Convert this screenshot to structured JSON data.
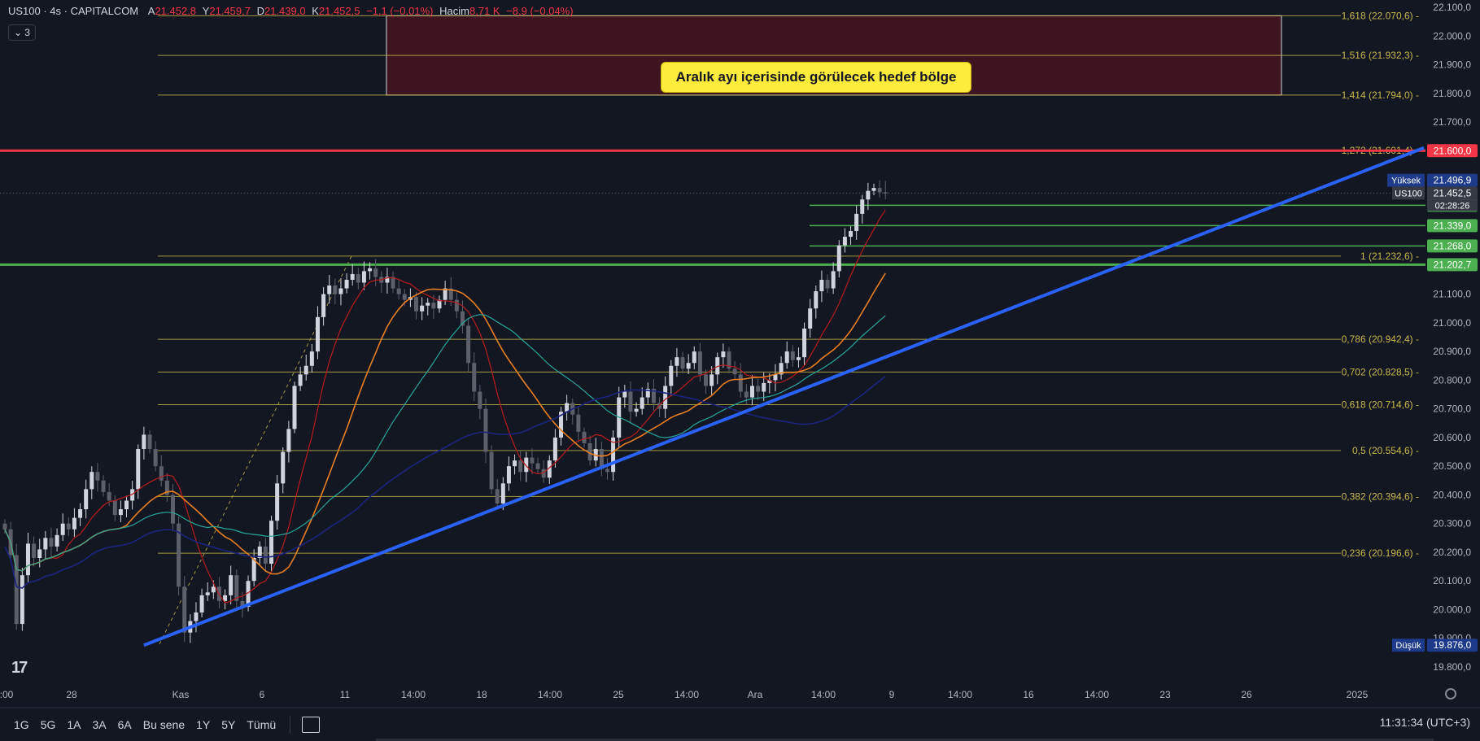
{
  "header": {
    "symbol": "US100 · 4s · CAPITALCOM",
    "open_label": "A",
    "open": "21.452,8",
    "high_label": "Y",
    "high": "21.459,7",
    "low_label": "D",
    "low": "21.439,0",
    "close_label": "K",
    "close": "21.452,5",
    "change": "−1,1 (−0,01%)",
    "volume_label": "Hacim",
    "volume": "8,71 K",
    "volume_change": "−8,9 (−0,04%)",
    "indicator_count": "3"
  },
  "annotation": {
    "target_zone_text": "Aralık ayı içerisinde görülecek hedef bölge"
  },
  "toolbar": {
    "timeframes": [
      "1G",
      "5G",
      "1A",
      "3A",
      "6A",
      "Bu sene",
      "1Y",
      "5Y",
      "Tümü"
    ],
    "clock": "11:31:34 (UTC+3)"
  },
  "colors": {
    "background": "#131722",
    "up_candle": "#d1d4dc",
    "down_candle": "#5d606b",
    "fib": "#c9b84c",
    "resistance": "#f23645",
    "support": "#4caf50",
    "trendline": "#2962ff",
    "target_zone": "#3d1420"
  },
  "chart_data": {
    "type": "candlestick",
    "title": "US100 · 4s · CAPITALCOM",
    "ylim": [
      19800,
      22100
    ],
    "y_ticks": [
      "22.100,0",
      "22.000,0",
      "21.900,0",
      "21.800,0",
      "21.700,0",
      "21.100,0",
      "21.000,0",
      "20.900,0",
      "20.800,0",
      "20.700,0",
      "20.600,0",
      "20.500,0",
      "20.400,0",
      "20.300,0",
      "20.200,0",
      "20.100,0",
      "20.000,0",
      "19.900,0",
      "19.800,0"
    ],
    "x_ticks": [
      ":00",
      "28",
      "Kas",
      "6",
      "11",
      "14:00",
      "18",
      "14:00",
      "25",
      "14:00",
      "Ara",
      "14:00",
      "9",
      "14:00",
      "16",
      "14:00",
      "23",
      "26",
      "2025"
    ],
    "fibonacci": [
      {
        "ratio": "1,618",
        "value": 22070.6,
        "label": "1,618 (22.070,6)"
      },
      {
        "ratio": "1,516",
        "value": 21932.3,
        "label": "1,516 (21.932,3)"
      },
      {
        "ratio": "1,414",
        "value": 21794.0,
        "label": "1,414 (21.794,0)"
      },
      {
        "ratio": "1,272",
        "value": 21601.4,
        "label": "1,272 (21.601,4)"
      },
      {
        "ratio": "1",
        "value": 21232.6,
        "label": "1 (21.232,6)"
      },
      {
        "ratio": "0,786",
        "value": 20942.4,
        "label": "0,786 (20.942,4)"
      },
      {
        "ratio": "0,702",
        "value": 20828.5,
        "label": "0,702 (20.828,5)"
      },
      {
        "ratio": "0,618",
        "value": 20714.6,
        "label": "0,618 (20.714,6)"
      },
      {
        "ratio": "0,5",
        "value": 20554.6,
        "label": "0,5 (20.554,6)"
      },
      {
        "ratio": "0,382",
        "value": 20394.6,
        "label": "0,382 (20.394,6)"
      },
      {
        "ratio": "0,236",
        "value": 20196.6,
        "label": "0,236 (20.196,6)"
      }
    ],
    "horizontal_levels": [
      {
        "value": 21600.0,
        "label": "21.600,0",
        "color": "#f23645"
      },
      {
        "value": 21202.7,
        "label": "21.202,7",
        "color": "#4caf50"
      },
      {
        "value": 21409.9,
        "label": "21.409,9",
        "color": "#4caf50"
      },
      {
        "value": 21339.0,
        "label": "21.339,0",
        "color": "#4caf50"
      },
      {
        "value": 21268.0,
        "label": "21.268,0",
        "color": "#4caf50"
      }
    ],
    "markers": [
      {
        "name": "Yüksek",
        "value": 21496.9,
        "label": "21.496,9"
      },
      {
        "name": "US100",
        "value": 21452.5,
        "label": "21.452,5",
        "countdown": "02:28:26"
      },
      {
        "name": "Düşük",
        "value": 19876.0,
        "label": "19.876,0"
      }
    ],
    "target_zone": {
      "from_value": 21794.0,
      "to_value": 22070.6
    },
    "trendline": {
      "from": [
        24,
        19876
      ],
      "to": [
        150,
        21610
      ]
    },
    "series": [
      {
        "values": [
          20280,
          20190,
          19950,
          20120,
          20230,
          20180,
          20210,
          20250,
          20220,
          20260,
          20300,
          20280,
          20320,
          20350,
          20420,
          20480,
          20450,
          20410,
          20380,
          20330,
          20350,
          20380,
          20420,
          20560,
          20610,
          20560,
          20500,
          20450,
          20400,
          20300,
          20080,
          19920,
          19960,
          19990,
          20050,
          20060,
          20080,
          20030,
          20050,
          20120,
          20030,
          20010,
          20100,
          20180,
          20220,
          20160,
          20310,
          20440,
          20550,
          20630,
          20780,
          20820,
          20850,
          20900,
          21020,
          21100,
          21130,
          21100,
          21120,
          21150,
          21170,
          21140,
          21180,
          21190,
          21160,
          21140,
          21160,
          21120,
          21100,
          21080,
          21090,
          21040,
          21060,
          21070,
          21050,
          21080,
          21120,
          21080,
          21040,
          20990,
          20860,
          20760,
          20700,
          20550,
          20420,
          20370,
          20440,
          20500,
          20520,
          20480,
          20530,
          20510,
          20490,
          20460,
          20520,
          20600,
          20690,
          20720,
          20680,
          20620,
          20580,
          20520,
          20560,
          20490,
          20480,
          20600,
          20740,
          20760,
          20690,
          20700,
          20740,
          20770,
          20720,
          20700,
          20780,
          20850,
          20880,
          20840,
          20860,
          20900,
          20820,
          20780,
          20820,
          20880,
          20900,
          20840,
          20820,
          20760,
          20740,
          20780,
          20760,
          20790,
          20800,
          20820,
          20860,
          20900,
          20870,
          20880,
          20980,
          21050,
          21110,
          21150,
          21120,
          21180,
          21270,
          21300,
          21320,
          21380,
          21430,
          21460,
          21470,
          21455,
          21452
        ]
      }
    ]
  }
}
